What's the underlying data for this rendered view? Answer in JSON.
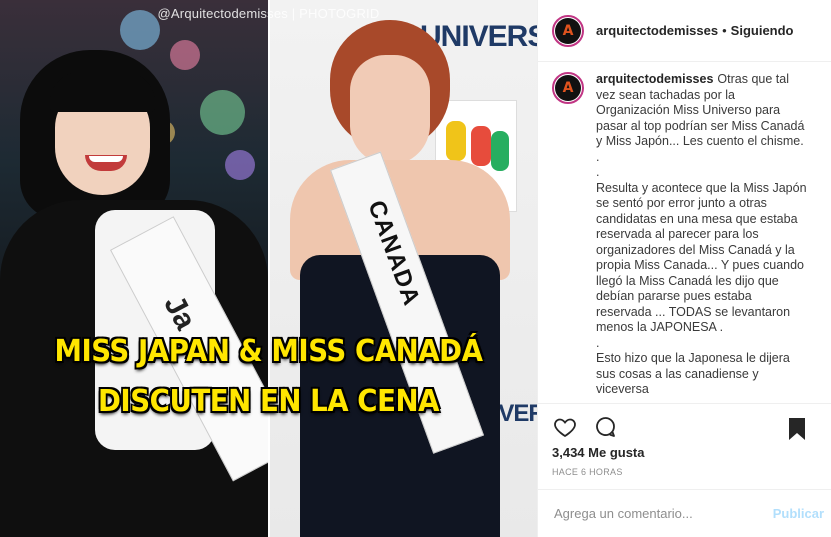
{
  "media": {
    "watermark": "@Arquitectodemisses | PHOTOGRID",
    "headline_line1": "MISS JAPAN & MISS CANADÁ",
    "headline_line2": "DISCUTEN EN LA CENA",
    "sash_left_text": "Ja",
    "sash_right_text": "CANADA",
    "backdrop_text": "UNIVERS"
  },
  "header": {
    "username": "arquitectodemisses",
    "separator": "•",
    "follow_status": "Siguiendo",
    "avatar_letter": "A"
  },
  "caption": {
    "username": "arquitectodemisses",
    "paragraphs": [
      "Otras que tal vez sean tachadas por la Organización Miss Universo para pasar al top podrían ser Miss Canadá y Miss Japón... Les cuento el chisme.",
      ".",
      ".",
      "Resulta y acontece que la Miss Japón se sentó por error junto a otras candidatas en una mesa que estaba reservada al parecer para los organizadores del Miss Canadá y la propia Miss Canada... Y pues cuando llegó la Miss Canadá les dijo que debían pararse pues estaba reservada ... TODAS se levantaron menos la JAPONESA .",
      ".",
      "Esto hizo que la Japonesa le dijera sus cosas a las canadiense y viceversa"
    ]
  },
  "actions": {
    "like_icon": "heart-icon",
    "comment_icon": "speech-bubble-icon",
    "save_icon": "bookmark-icon"
  },
  "likes": "3,434 Me gusta",
  "time_ago": "HACE 6 HORAS",
  "comment_box": {
    "placeholder": "Agrega un comentario...",
    "post_label": "Publicar"
  },
  "colors": {
    "headline": "#ffe600",
    "post_button_disabled": "#b2dffc",
    "avatar_ring": "#c13584"
  }
}
